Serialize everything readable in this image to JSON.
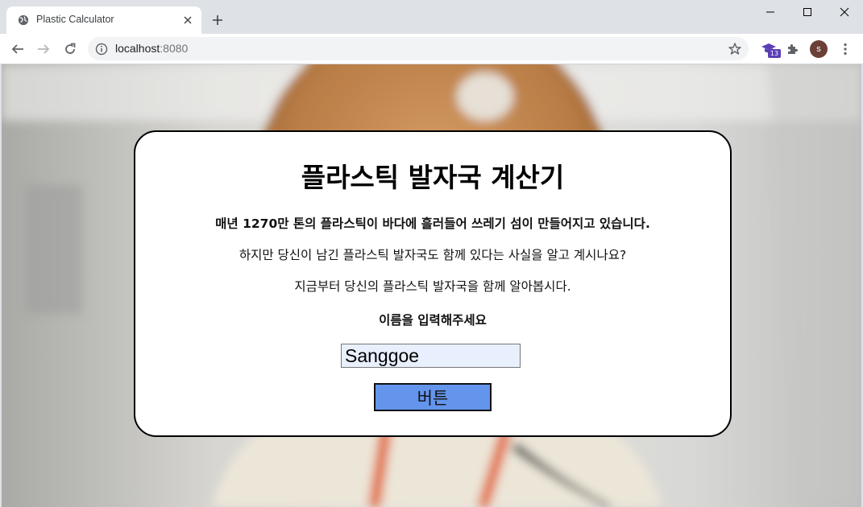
{
  "browser": {
    "tab_title": "Plastic Calculator",
    "url_host": "localhost",
    "url_port": ":8080",
    "extension_badge": "13",
    "profile_initial": "s",
    "icons": [
      "globe-icon",
      "close-icon",
      "plus-icon",
      "minimize-icon",
      "maximize-icon",
      "back-icon",
      "forward-icon",
      "reload-icon",
      "info-icon",
      "star-icon",
      "puzzle-icon",
      "kebab-menu-icon"
    ]
  },
  "card": {
    "title": "플라스틱 발자국 계산기",
    "line1": "매년 1270만 톤의 플라스틱이 바다에 흘러들어 쓰레기 섬이 만들어지고 있습니다.",
    "line2": "하지만 당신이 남긴 플라스틱 발자국도 함께 있다는 사실을 알고 계시나요?",
    "line3": "지금부터 당신의 플라스틱 발자국을 함께 알아봅시다.",
    "prompt": "이름을 입력해주세요",
    "name_value": "Sanggoe",
    "button_label": "버튼"
  },
  "colors": {
    "button": "#6495ed",
    "input_autofill": "#e8f0fe",
    "badge": "#5b3fb5"
  }
}
